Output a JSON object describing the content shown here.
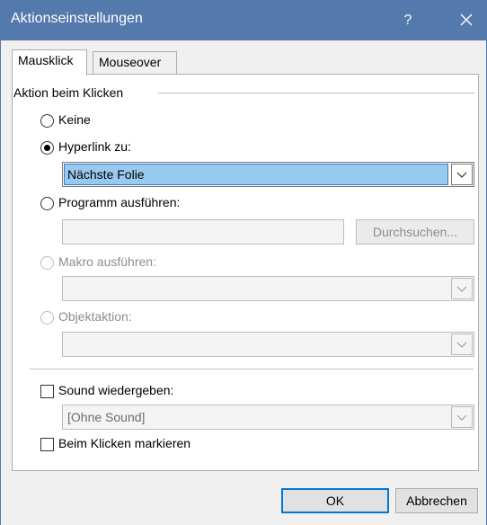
{
  "window": {
    "title": "Aktionseinstellungen",
    "help_label": "?",
    "title_bar_color": "#5479ad"
  },
  "tabs": [
    {
      "label": "Mausklick",
      "active": true
    },
    {
      "label": "Mouseover",
      "active": false
    }
  ],
  "action_group": {
    "label": "Aktion beim Klicken",
    "options": {
      "keine": {
        "label": "Keine",
        "checked": false,
        "enabled": true
      },
      "hyperlink": {
        "label": "Hyperlink zu:",
        "checked": true,
        "enabled": true
      },
      "programm": {
        "label": "Programm ausführen:",
        "checked": false,
        "enabled": true
      },
      "makro": {
        "label": "Makro ausführen:",
        "checked": false,
        "enabled": false
      },
      "objekt": {
        "label": "Objektaktion:",
        "checked": false,
        "enabled": false
      }
    },
    "hyperlink_value": "Nächste Folie",
    "program_path": "",
    "browse_label": "Durchsuchen...",
    "macro_value": "",
    "object_value": ""
  },
  "sound": {
    "label": "Sound wiedergeben:",
    "checked": false,
    "value": "[Ohne Sound]"
  },
  "highlight": {
    "label": "Beim Klicken markieren",
    "checked": false
  },
  "buttons": {
    "ok": "OK",
    "cancel": "Abbrechen"
  },
  "colors": {
    "selection": "#99c9ef",
    "default_button_border": "#0078d7"
  }
}
